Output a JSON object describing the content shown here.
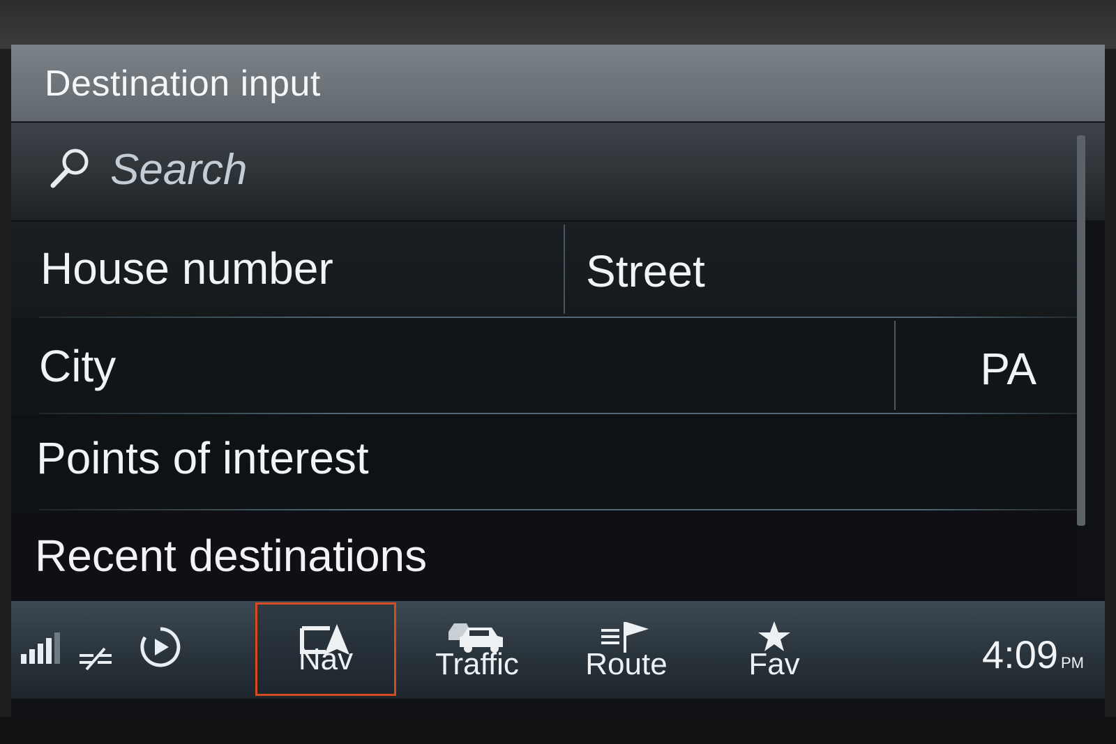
{
  "header": {
    "title": "Destination input"
  },
  "search": {
    "placeholder": "Search",
    "icon": "search-icon"
  },
  "rows": [
    {
      "cells": [
        {
          "label": "House number"
        },
        {
          "label": "Street"
        }
      ]
    },
    {
      "cells": [
        {
          "label": "City"
        },
        {
          "label": "PA"
        }
      ]
    },
    {
      "cells": [
        {
          "label": "Points of interest"
        }
      ]
    },
    {
      "cells": [
        {
          "label": "Recent destinations"
        }
      ]
    }
  ],
  "toolbar": {
    "status_icons": [
      "signal-strength-icon",
      "no-connection-icon",
      "media-play-icon"
    ],
    "buttons": [
      {
        "label": "Nav",
        "icon": "nav-icon",
        "selected": true
      },
      {
        "label": "Traffic",
        "icon": "traffic-icon",
        "selected": false
      },
      {
        "label": "Route",
        "icon": "route-flag-icon",
        "selected": false
      },
      {
        "label": "Fav",
        "icon": "star-icon",
        "selected": false
      }
    ],
    "clock": {
      "time": "4:09",
      "ampm": "PM"
    }
  },
  "colors": {
    "selection_border": "#d34b23",
    "header_bg": "#6b7379",
    "screen_bg": "#0f1114"
  }
}
